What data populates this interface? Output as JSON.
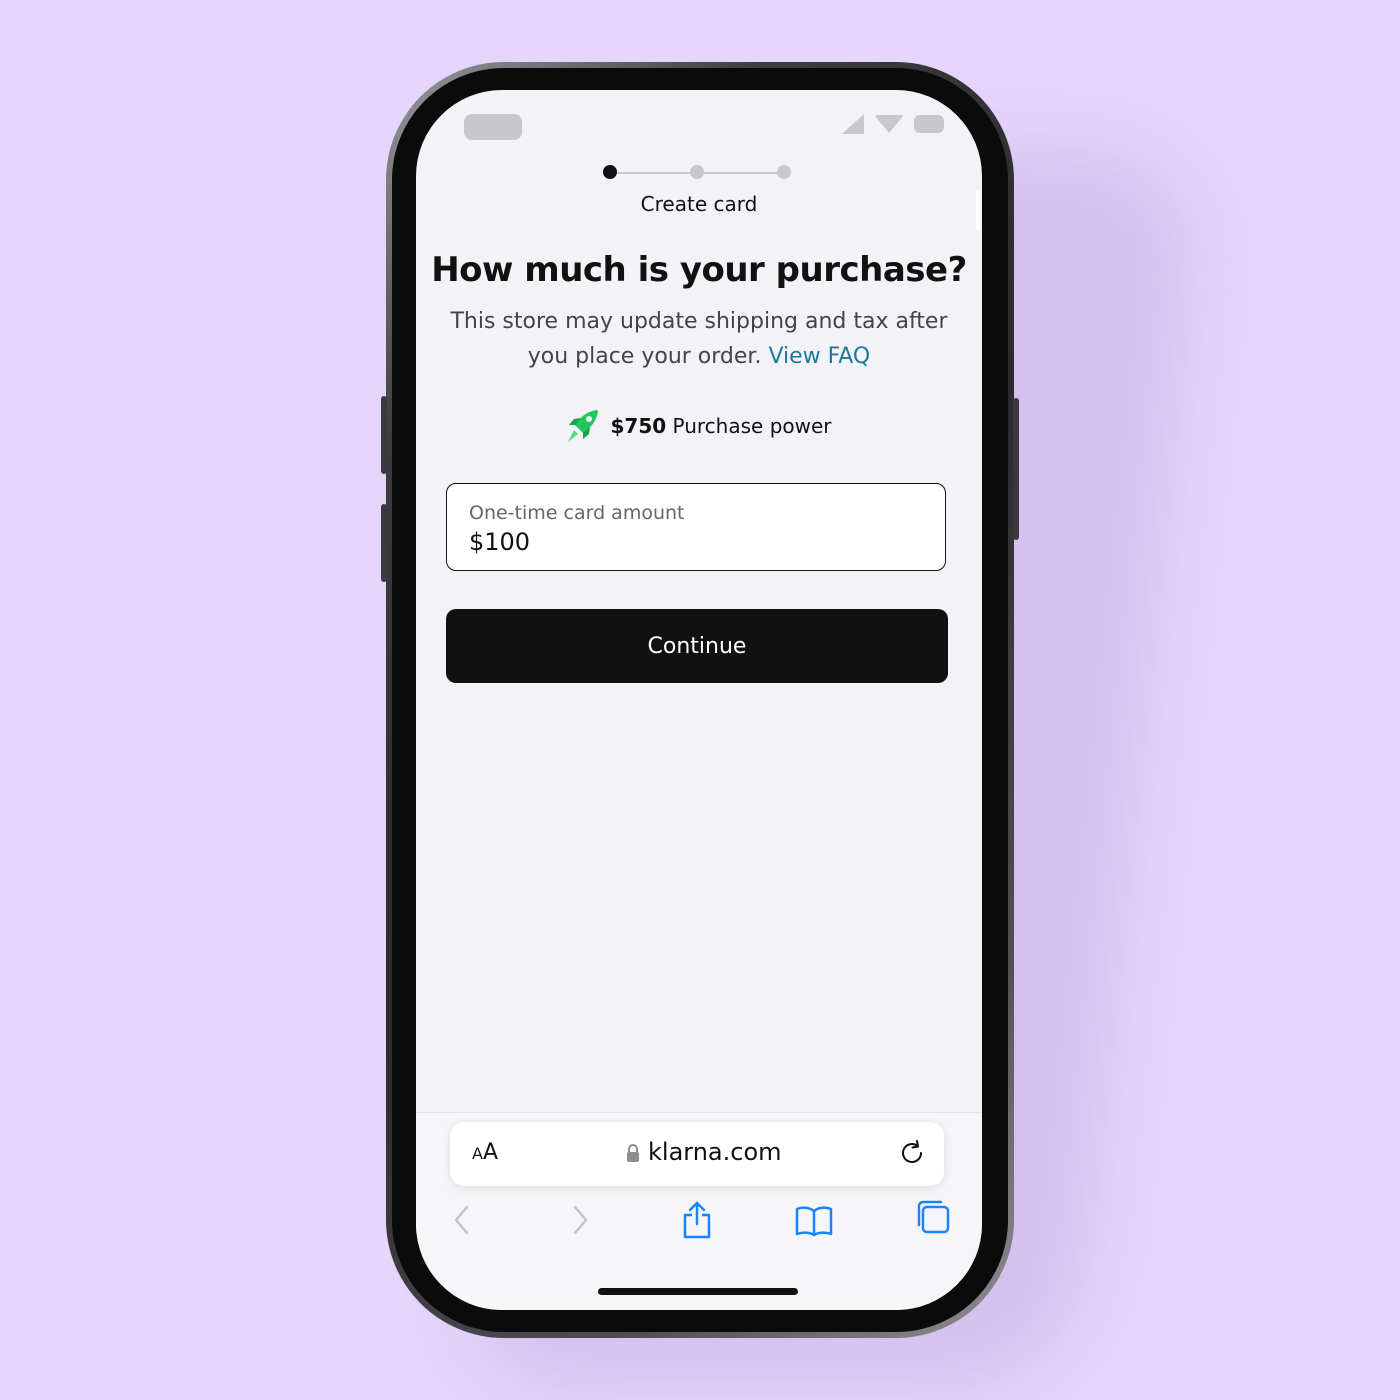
{
  "colors": {
    "background": "#e6d6fb",
    "screen": "#f2f2f7",
    "primary_button": "#111111",
    "link": "#1e7a9a",
    "rocket_icon": "#22c55e",
    "safari_blue": "#1a84ff"
  },
  "stepper": {
    "current_step": 1,
    "total_steps": 3,
    "label": "Create card"
  },
  "headline": "How much is your purchase?",
  "subtext": {
    "text": "This store may update shipping and tax after you place your order.",
    "link_label": "View FAQ"
  },
  "purchase_power": {
    "icon": "rocket-icon",
    "amount": "$750",
    "label": "Purchase power"
  },
  "amount_field": {
    "label": "One-time card amount",
    "value": "$100"
  },
  "continue_button": {
    "label": "Continue"
  },
  "browser": {
    "text_size_label_small": "A",
    "text_size_label_large": "A",
    "domain": "klarna.com",
    "icons": [
      "lock-icon",
      "reload-icon",
      "back-icon",
      "forward-icon",
      "share-icon",
      "bookmarks-icon",
      "tabs-icon"
    ]
  }
}
